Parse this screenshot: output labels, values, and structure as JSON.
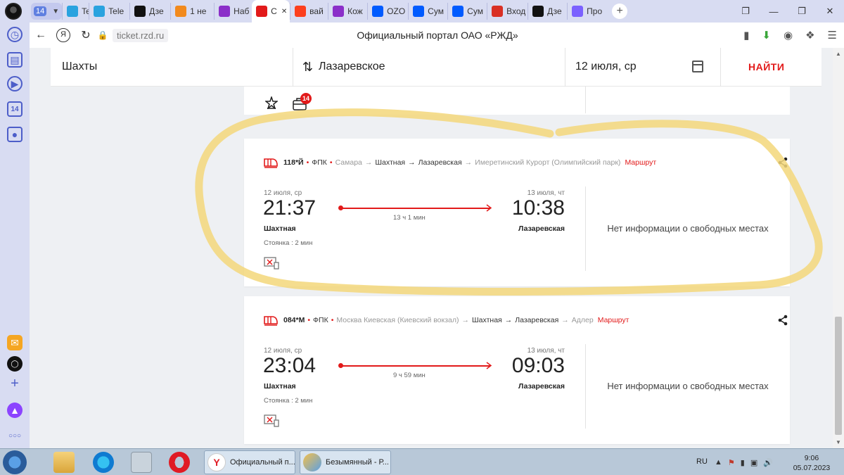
{
  "browser": {
    "tab_group_count": "14",
    "tabs": [
      {
        "label": "Tele",
        "icon": "telegram-icon",
        "color": "#2aa3df"
      },
      {
        "label": "Tele",
        "icon": "telegram-icon",
        "color": "#2aa3df"
      },
      {
        "label": "Дзе",
        "icon": "dzen-icon",
        "color": "#111111"
      },
      {
        "label": "1 не",
        "icon": "orange-icon",
        "color": "#f28a1e"
      },
      {
        "label": "Наб",
        "icon": "wildberries-icon",
        "color": "#8b2fc9"
      },
      {
        "label": "С",
        "icon": "rzd-icon",
        "color": "#e21a1a",
        "active": true
      },
      {
        "label": "вай",
        "icon": "yandex-icon",
        "color": "#fc3f1d"
      },
      {
        "label": "Кож",
        "icon": "wildberries-icon",
        "color": "#8b2fc9"
      },
      {
        "label": "OZO",
        "icon": "ozon-icon",
        "color": "#005bff"
      },
      {
        "label": "Сум",
        "icon": "ozon-icon",
        "color": "#005bff"
      },
      {
        "label": "Сум",
        "icon": "ozon-icon",
        "color": "#005bff"
      },
      {
        "label": "Вход",
        "icon": "gmail-icon",
        "color": "#d93025"
      },
      {
        "label": "Дзе",
        "icon": "dzen-icon",
        "color": "#111111"
      },
      {
        "label": "Про",
        "icon": "pro-icon",
        "color": "#7b61ff"
      }
    ],
    "url": "ticket.rzd.ru",
    "page_title": "Официальный портал ОАО «РЖД»",
    "sidebar_badge": "14"
  },
  "search": {
    "from": "Шахты",
    "to": "Лазаревское",
    "date": "12 июля, ср",
    "find_label": "НАЙТИ"
  },
  "prev_card": {
    "badge": "14"
  },
  "trains": [
    {
      "number": "118*Й",
      "carrier": "ФПК",
      "route": [
        {
          "name": "Самара",
          "style": "gray"
        },
        {
          "name": "Шахтная",
          "style": "dark"
        },
        {
          "name": "Лазаревская",
          "style": "dark"
        },
        {
          "name": "Имеретинский Курорт (Олимпийский парк)",
          "style": "gray"
        }
      ],
      "route_link": "Маршрут",
      "dep_date": "12 июля, ср",
      "dep_time": "21:37",
      "dep_station": "Шахтная",
      "arr_date": "13 июля, чт",
      "arr_time": "10:38",
      "arr_station": "Лазаревская",
      "duration": "13 ч 1 мин",
      "stop": "Стоянка : 2 мин",
      "seats": "Нет информации о свободных местах"
    },
    {
      "number": "084*М",
      "carrier": "ФПК",
      "route": [
        {
          "name": "Москва Киевская (Киевский вокзал)",
          "style": "gray"
        },
        {
          "name": "Шахтная",
          "style": "dark"
        },
        {
          "name": "Лазаревская",
          "style": "dark"
        },
        {
          "name": "Адлер",
          "style": "gray"
        }
      ],
      "route_link": "Маршрут",
      "dep_date": "12 июля, ср",
      "dep_time": "23:04",
      "dep_station": "Шахтная",
      "arr_date": "13 июля, чт",
      "arr_time": "09:03",
      "arr_station": "Лазаревская",
      "duration": "9 ч 59 мин",
      "stop": "Стоянка : 2 мин",
      "seats": "Нет информации о свободных местах"
    }
  ],
  "taskbar": {
    "tasks": [
      {
        "label": "Официальный п...",
        "icon": "yandex-browser-icon"
      },
      {
        "label": "Безымянный - Р...",
        "icon": "paint-icon"
      }
    ],
    "lang": "RU",
    "time": "9:06",
    "date": "05.07.2023"
  },
  "colors": {
    "accent": "#e21a1a",
    "highlight": "#f3d77a"
  }
}
